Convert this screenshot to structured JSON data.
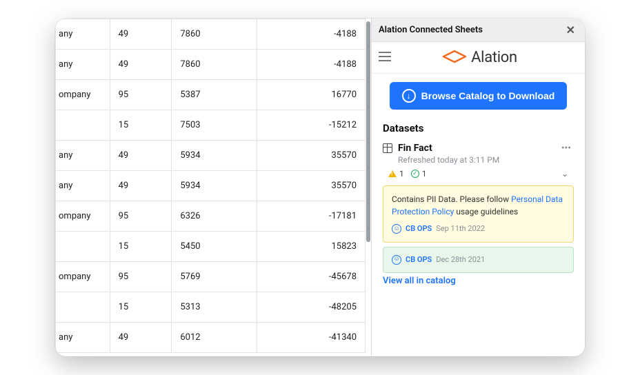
{
  "sheet": {
    "rows": [
      {
        "a": "any",
        "b": "49",
        "c": "7860",
        "d": "-4188"
      },
      {
        "a": "any",
        "b": "49",
        "c": "7860",
        "d": "-4188"
      },
      {
        "a": "ompany",
        "b": "95",
        "c": "5387",
        "d": "16770"
      },
      {
        "a": "",
        "b": "15",
        "c": "7503",
        "d": "-15212"
      },
      {
        "a": "any",
        "b": "49",
        "c": "5934",
        "d": "35570"
      },
      {
        "a": "any",
        "b": "49",
        "c": "5934",
        "d": "35570"
      },
      {
        "a": "ompany",
        "b": "95",
        "c": "6326",
        "d": "-17181"
      },
      {
        "a": "",
        "b": "15",
        "c": "5450",
        "d": "15823"
      },
      {
        "a": "ompany",
        "b": "95",
        "c": "5769",
        "d": "-45678"
      },
      {
        "a": "",
        "b": "15",
        "c": "5313",
        "d": "-48205"
      },
      {
        "a": "any",
        "b": "49",
        "c": "6012",
        "d": "-41340"
      }
    ]
  },
  "panel": {
    "title": "Alation Connected Sheets",
    "brand": "Alation",
    "browse_button": "Browse Catalog to Download",
    "section": "Datasets",
    "dataset": {
      "name": "Fin Fact",
      "refreshed": "Refreshed today at 3:11 PM",
      "warn_count": "1",
      "ok_count": "1"
    },
    "warn_box": {
      "text_before": "Contains PII Data. Please follow ",
      "link": "Personal Data Protection Policy",
      "text_after": " usage guidelines",
      "user": "CB OPS",
      "date": "Sep 11th 2022"
    },
    "ok_box": {
      "user": "CB OPS",
      "date": "Dec 28th 2021"
    },
    "view_all": "View all in catalog"
  }
}
